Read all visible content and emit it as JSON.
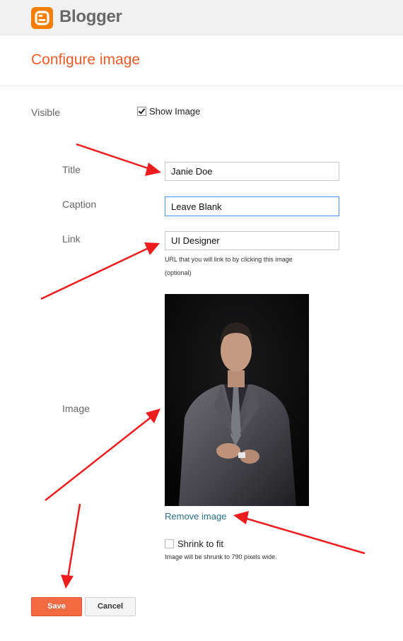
{
  "header": {
    "brand": "Blogger",
    "logo_icon": "blogger-logo-icon"
  },
  "page": {
    "title": "Configure image"
  },
  "form": {
    "visible_label": "Visible",
    "show_image_label": "Show Image",
    "show_image_checked": true,
    "title_label": "Title",
    "title_value": "Janie Doe",
    "caption_label": "Caption",
    "caption_value": "Leave Blank",
    "link_label": "Link",
    "link_value": "UI Designer",
    "link_hint_line1": "URL that you will link to by clicking this image",
    "link_hint_line2": "(optional)",
    "image_label": "Image",
    "remove_image": "Remove image",
    "shrink_label": "Shrink to fit",
    "shrink_checked": false,
    "shrink_hint": "Image will be shrunk to 790 pixels wide."
  },
  "buttons": {
    "save": "Save",
    "cancel": "Cancel"
  },
  "colors": {
    "accent": "#f05a28",
    "arrow": "#ee1c1c",
    "link": "#2a6f8c",
    "save_bg": "#f26b43"
  }
}
